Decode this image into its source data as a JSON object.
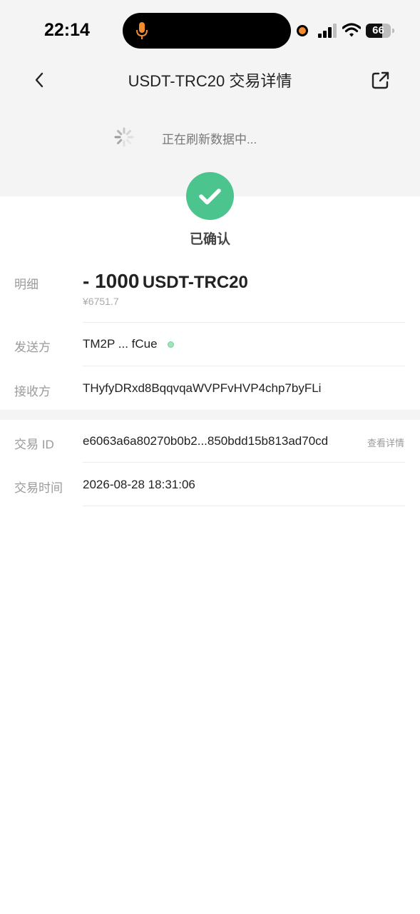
{
  "status_bar": {
    "time": "22:14",
    "battery_level": "66",
    "battery_fraction": 0.66,
    "icons": [
      "microphone-icon",
      "recording-dot-icon",
      "cellular-signal-icon",
      "wifi-icon",
      "battery-icon"
    ],
    "recording_color": "#f28b30"
  },
  "nav": {
    "back_icon": "chevron-left-icon",
    "title": "USDT-TRC20 交易详情",
    "share_icon": "share-external-icon"
  },
  "refresh": {
    "icon": "spinner-icon",
    "text": "正在刷新数据中..."
  },
  "status": {
    "icon": "checkmark-icon",
    "label": "已确认",
    "color": "#4cc48e"
  },
  "details": {
    "amount_label": "明细",
    "amount_value": "- 1000",
    "amount_unit": "USDT-TRC20",
    "amount_fiat": "¥6751.7",
    "sender_label": "发送方",
    "sender_value": "TM2P ... fCue",
    "receiver_label": "接收方",
    "receiver_value": "THyfyDRxd8BqqvqaWVPFvHVP4chp7byFLi"
  },
  "tx": {
    "id_label": "交易 ID",
    "id_value": "e6063a6a80270b0b2...850bdd15b813ad70cd",
    "view_detail_link": "查看详情",
    "time_label": "交易时间",
    "time_value": "2026-08-28 18:31:06"
  }
}
